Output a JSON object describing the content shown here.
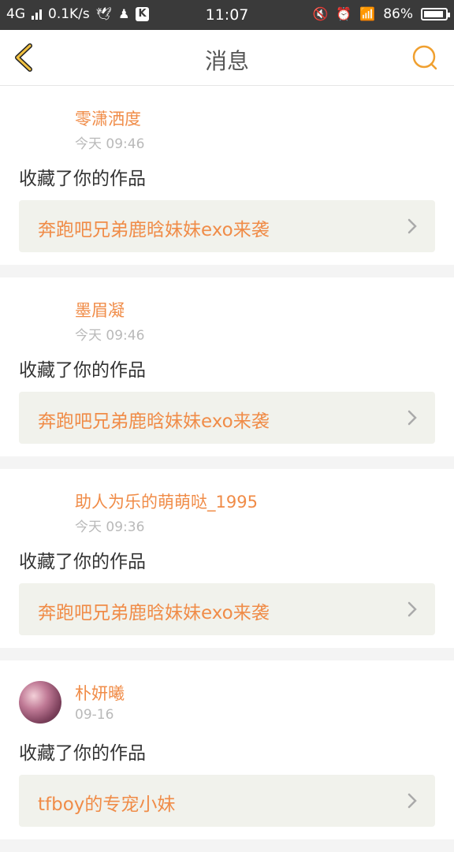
{
  "status_bar": {
    "network": "4G",
    "speed": "0.1K/s",
    "time": "11:07",
    "battery": "86%",
    "battery_level": 0.86
  },
  "header": {
    "title": "消息",
    "back_icon": "chevron-left-icon",
    "search_icon": "search-icon",
    "accent_color": "#f0a030"
  },
  "messages": [
    {
      "user": "零潇洒度",
      "time": "今天 09:46",
      "action": "收藏了你的作品",
      "work": "奔跑吧兄弟鹿晗妹妹exo来袭"
    },
    {
      "user": "墨眉凝",
      "time": "今天 09:46",
      "action": "收藏了你的作品",
      "work": "奔跑吧兄弟鹿晗妹妹exo来袭"
    },
    {
      "user": "助人为乐的萌萌哒_1995",
      "time": "今天 09:36",
      "action": "收藏了你的作品",
      "work": "奔跑吧兄弟鹿晗妹妹exo来袭"
    },
    {
      "user": "朴妍曦",
      "time": "09-16",
      "action": "收藏了你的作品",
      "work": "tfboy的专宠小妹"
    }
  ],
  "colors": {
    "username": "#f08c48",
    "work_title": "#f08c48",
    "timestamp": "#b9b9b9"
  }
}
